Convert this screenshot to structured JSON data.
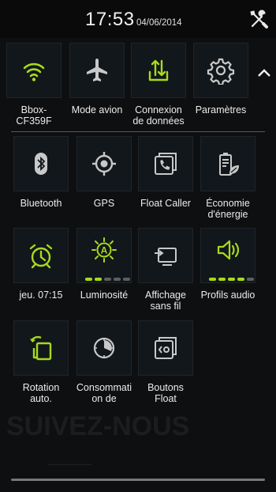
{
  "status_bar": {
    "time": "17:53",
    "date": "04/06/2014"
  },
  "colors": {
    "accent": "#a8d91e",
    "icon_grey": "#c8c8c8"
  },
  "top_row": [
    {
      "key": "wifi",
      "label": "Bbox-\nCF359F",
      "icon": "wifi-icon"
    },
    {
      "key": "airplane",
      "label": "Mode avion",
      "icon": "airplane-icon"
    },
    {
      "key": "data",
      "label": "Connexion\nde données",
      "icon": "data-transfer-icon"
    },
    {
      "key": "settings",
      "label": "Paramètres",
      "icon": "gear-icon"
    }
  ],
  "grid": [
    {
      "key": "bluetooth",
      "label": "Bluetooth",
      "icon": "bluetooth-icon"
    },
    {
      "key": "gps",
      "label": "GPS",
      "icon": "gps-icon"
    },
    {
      "key": "float_caller",
      "label": "Float Caller",
      "icon": "phone-icon"
    },
    {
      "key": "power_saving",
      "label": "Économie\nd'énergie",
      "icon": "battery-leaf-icon"
    },
    {
      "key": "alarm",
      "label": "jeu. 07:15",
      "icon": "alarm-clock-icon"
    },
    {
      "key": "brightness",
      "label": "Luminosité",
      "icon": "brightness-icon",
      "level": 2,
      "max": 5
    },
    {
      "key": "wireless_display",
      "label": "Affichage\nsans fil",
      "icon": "cast-icon"
    },
    {
      "key": "audio_profiles",
      "label": "Profils audio",
      "icon": "volume-icon",
      "level": 4,
      "max": 5
    },
    {
      "key": "rotation",
      "label": "Rotation\nauto.",
      "icon": "rotation-icon"
    },
    {
      "key": "consumption",
      "label": "Consommati\non de",
      "icon": "timer-icon"
    },
    {
      "key": "float_buttons",
      "label": "Boutons\nFloat",
      "icon": "float-buttons-icon"
    }
  ]
}
